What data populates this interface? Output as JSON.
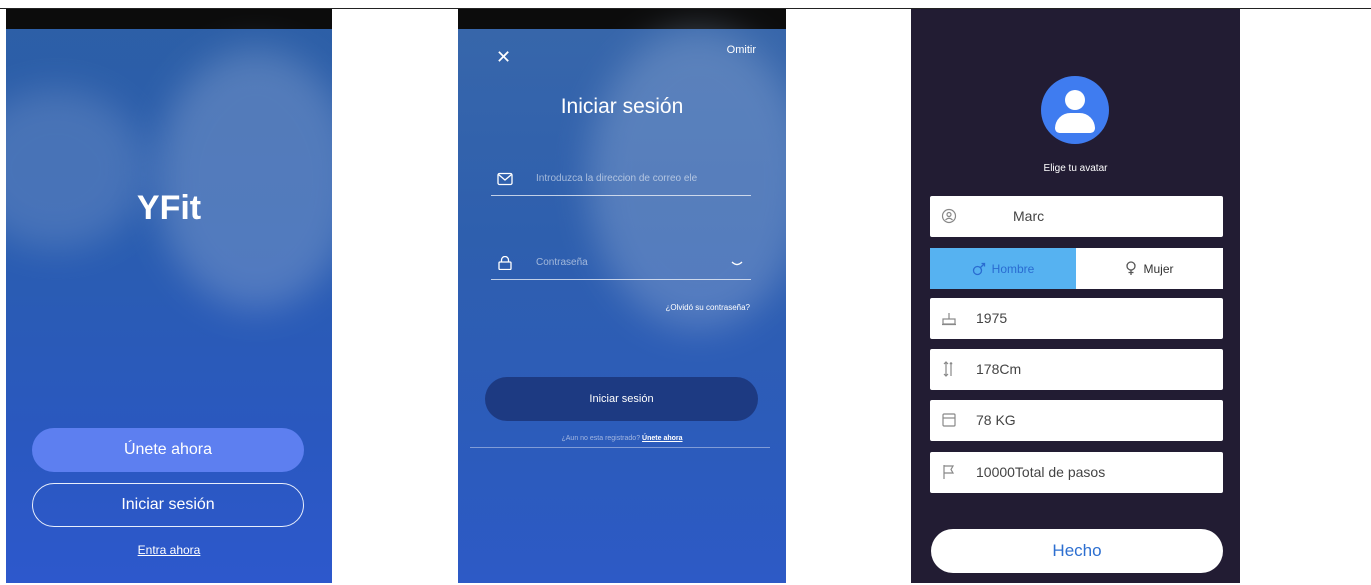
{
  "screen1": {
    "logo": "YFit",
    "join_label": "Únete ahora",
    "login_label": "Iniciar sesión",
    "enter_label": "Entra ahora"
  },
  "screen2": {
    "close_icon": "close-icon",
    "skip_label": "Omitir",
    "title": "Iniciar sesión",
    "email_placeholder": "Introduzca la direccion de correo ele",
    "password_placeholder": "Contraseña",
    "forgot_label": "¿Olvidó su contraseña?",
    "login_button": "Iniciar sesión",
    "register_prompt": "¿Aun no esta registrado?",
    "register_link": "Únete ahora"
  },
  "screen3": {
    "avatar_label": "Elige tu avatar",
    "name": "Marc",
    "gender_male": "Hombre",
    "gender_female": "Mujer",
    "selected_gender": "Hombre",
    "birth_year": "1975",
    "height": "178Cm",
    "weight": "78 KG",
    "steps": "10000Total de pasos",
    "done_label": "Hecho"
  },
  "colors": {
    "accent_blue": "#5d7ff0",
    "dark_bg": "#221c33",
    "male_selected": "#56b2f1"
  }
}
